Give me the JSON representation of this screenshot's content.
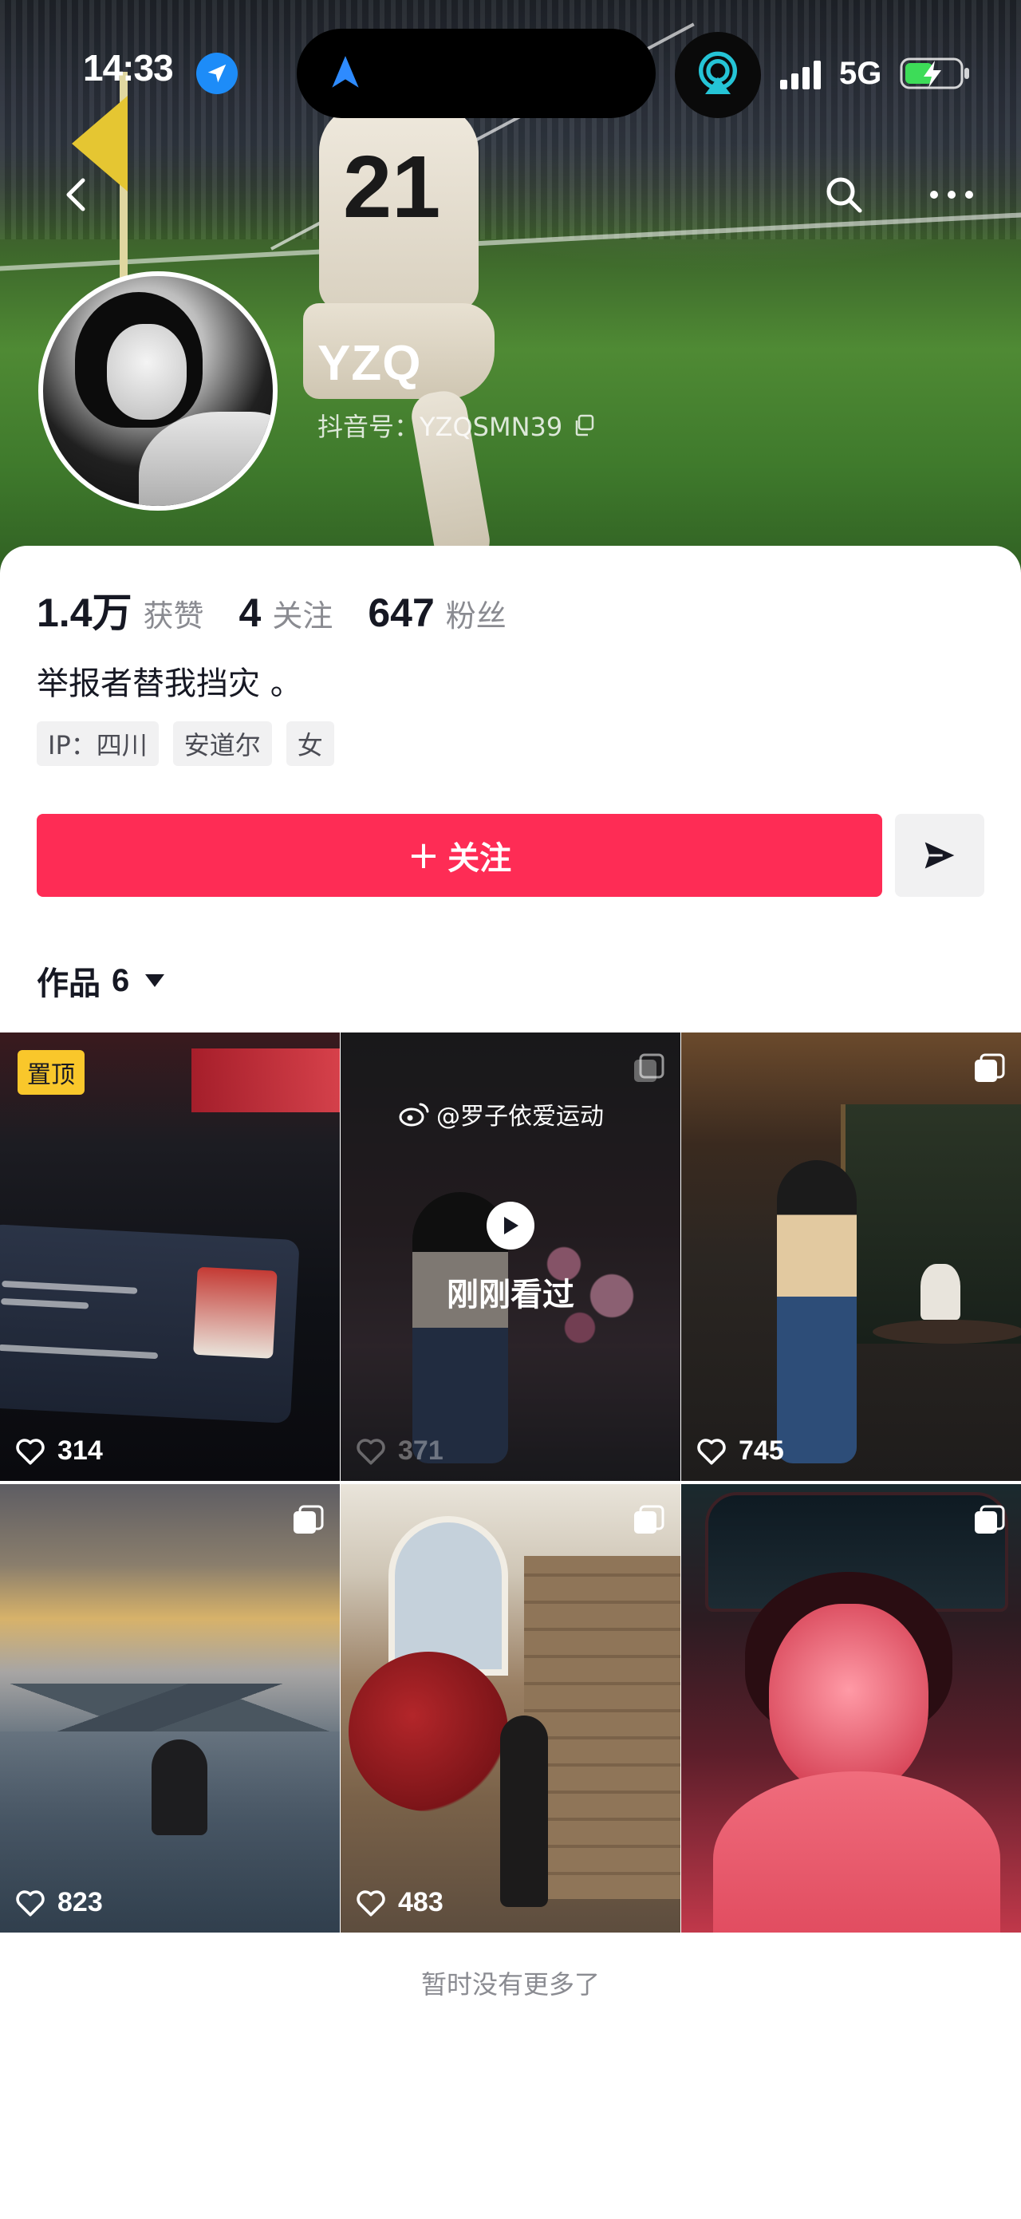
{
  "status_bar": {
    "time": "14:33",
    "network": "5G",
    "icons": [
      "location-arrow-icon",
      "navigation-icon",
      "airplay-icon",
      "signal-icon",
      "battery-charging-icon"
    ]
  },
  "header": {
    "icons": [
      "back-icon",
      "search-icon",
      "more-icon"
    ]
  },
  "profile": {
    "name": "YZQ",
    "douyin_id": "抖音号：YZQSMN39",
    "stats": [
      {
        "value": "1.4万",
        "label": "获赞"
      },
      {
        "value": "4",
        "label": "关注"
      },
      {
        "value": "647",
        "label": "粉丝"
      }
    ],
    "bio": "举报者替我挡灾 。",
    "tags": [
      "IP：四川",
      "安道尔",
      "女"
    ]
  },
  "actions": {
    "follow_label": "关注",
    "follow_color": "#fe2c55"
  },
  "works_tab": {
    "label": "作品",
    "count": "6"
  },
  "videos": [
    {
      "likes": "314",
      "pinned": true,
      "pin_label": "置顶",
      "multi_image": false
    },
    {
      "likes": "371",
      "watermark": "@罗子依爱运动",
      "overlay": "刚刚看过",
      "multi_image": true,
      "dimmed": true
    },
    {
      "likes": "745",
      "multi_image": true
    },
    {
      "likes": "823",
      "multi_image": true
    },
    {
      "likes": "483",
      "multi_image": true
    },
    {
      "likes": "",
      "multi_image": true
    }
  ],
  "footer": {
    "no_more": "暂时没有更多了"
  }
}
